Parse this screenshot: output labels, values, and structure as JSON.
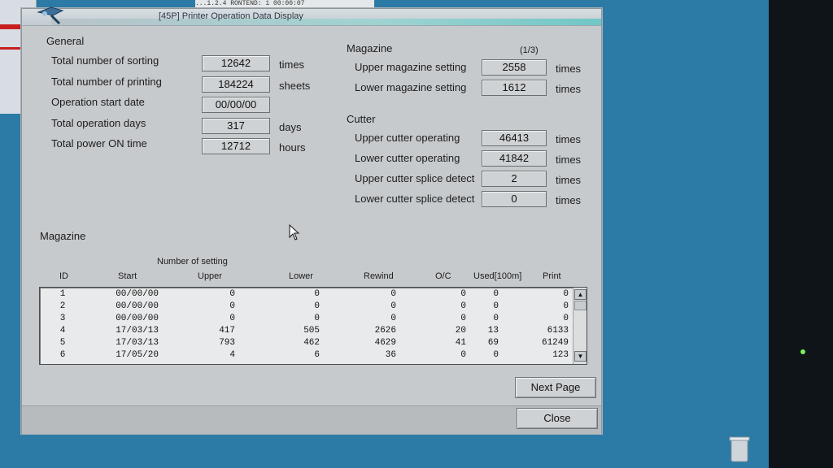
{
  "topbar": {
    "text": "...1.2.4 RONTEND: 1 00:00:07"
  },
  "window": {
    "title": "[45P] Printer Operation Data Display"
  },
  "general": {
    "heading": "General",
    "rows": [
      {
        "label": "Total number of sorting",
        "value": "12642",
        "unit": "times"
      },
      {
        "label": "Total number of printing",
        "value": "184224",
        "unit": "sheets"
      },
      {
        "label": "Operation start date",
        "value": "00/00/00",
        "unit": ""
      },
      {
        "label": "Total operation days",
        "value": "317",
        "unit": "days"
      },
      {
        "label": "Total power ON time",
        "value": "12712",
        "unit": "hours"
      }
    ]
  },
  "magazine_section": {
    "heading": "Magazine",
    "page_indicator": "(1/3)",
    "rows": [
      {
        "label": "Upper magazine setting",
        "value": "2558",
        "unit": "times"
      },
      {
        "label": "Lower magazine setting",
        "value": "1612",
        "unit": "times"
      }
    ]
  },
  "cutter": {
    "heading": "Cutter",
    "rows": [
      {
        "label": "Upper cutter operating",
        "value": "46413",
        "unit": "times"
      },
      {
        "label": "Lower cutter operating",
        "value": "41842",
        "unit": "times"
      },
      {
        "label": "Upper cutter splice detect",
        "value": "2",
        "unit": "times"
      },
      {
        "label": "Lower cutter splice detect",
        "value": "0",
        "unit": "times"
      }
    ]
  },
  "magazine_table": {
    "heading": "Magazine",
    "group_header": "Number of setting",
    "columns": [
      "ID",
      "Start",
      "Upper",
      "Lower",
      "Rewind",
      "O/C",
      "Used[100m]",
      "Print"
    ],
    "rows": [
      [
        "1",
        "00/00/00",
        "0",
        "0",
        "0",
        "0",
        "0",
        "0"
      ],
      [
        "2",
        "00/00/00",
        "0",
        "0",
        "0",
        "0",
        "0",
        "0"
      ],
      [
        "3",
        "00/00/00",
        "0",
        "0",
        "0",
        "0",
        "0",
        "0"
      ],
      [
        "4",
        "17/03/13",
        "417",
        "505",
        "2626",
        "20",
        "13",
        "6133"
      ],
      [
        "5",
        "17/03/13",
        "793",
        "462",
        "4629",
        "41",
        "69",
        "61249"
      ],
      [
        "6",
        "17/05/20",
        "4",
        "6",
        "36",
        "0",
        "0",
        "123"
      ]
    ]
  },
  "buttons": {
    "next_page": "Next Page",
    "close": "Close"
  },
  "icons": {
    "scroll_up": "▲",
    "scroll_down": "▼"
  },
  "colors": {
    "desktop": "#2c7aa6",
    "dialog": "#c7cacd",
    "title_accent": "#6fc7c6"
  }
}
